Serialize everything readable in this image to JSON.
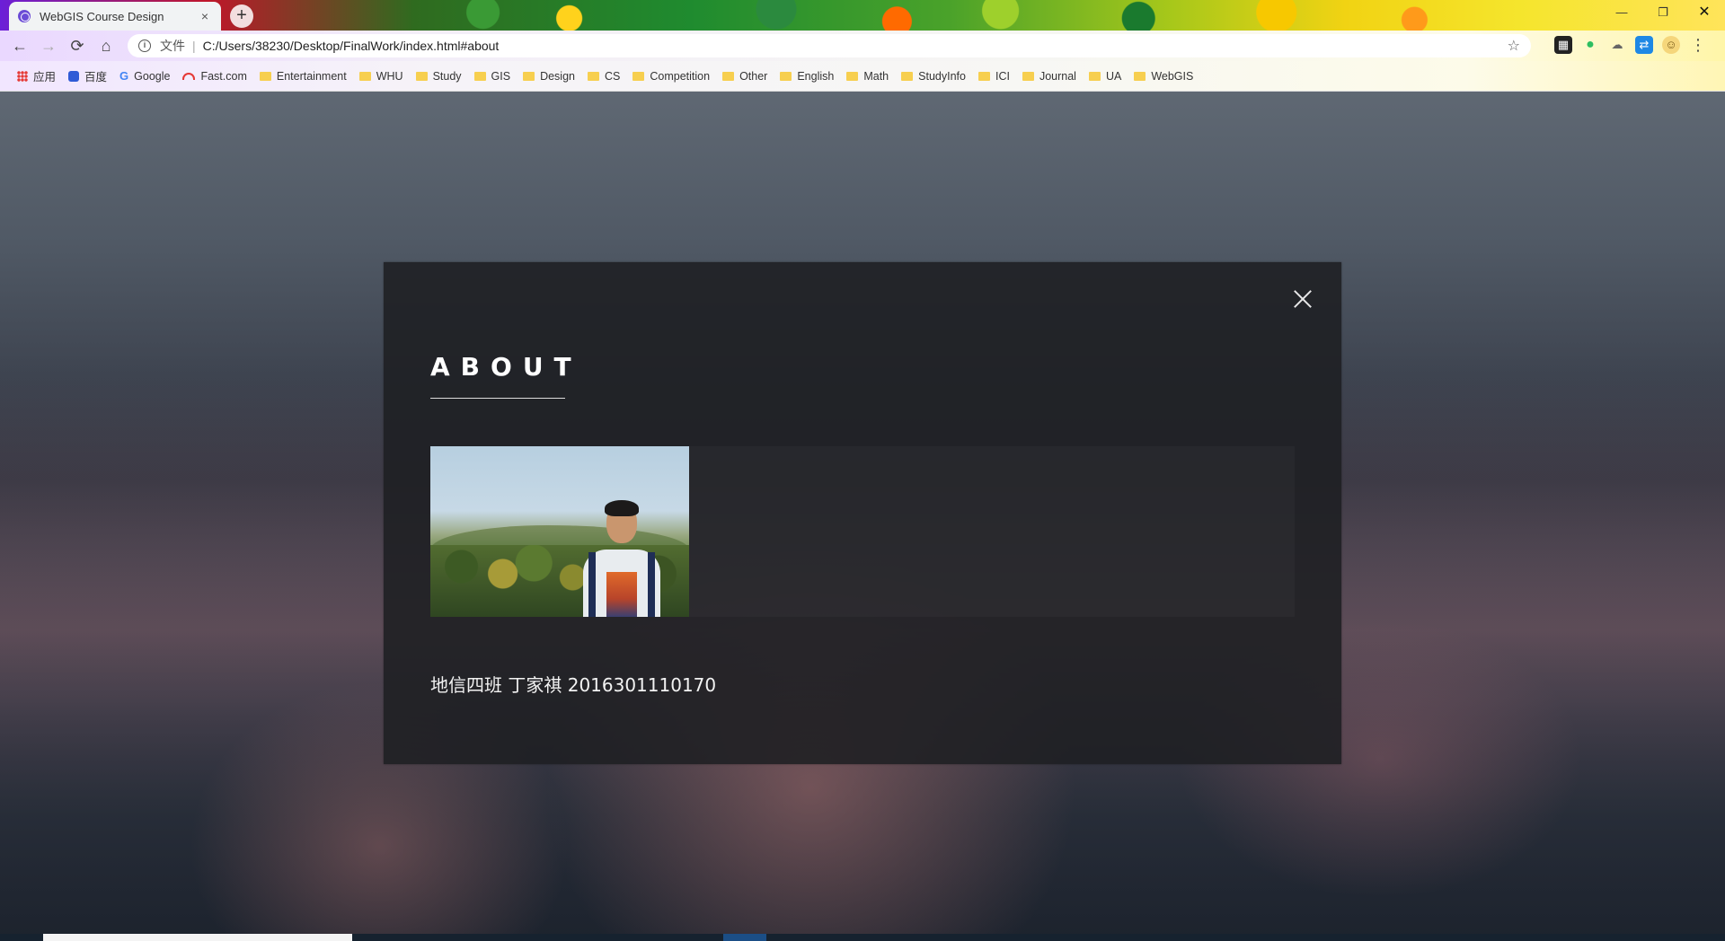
{
  "browser": {
    "tab": {
      "title": "WebGIS Course Design",
      "close_glyph": "×"
    },
    "new_tab_glyph": "+",
    "window_controls": {
      "minimize": "—",
      "maximize": "❐",
      "close": "✕"
    },
    "nav": {
      "back": "←",
      "forward": "→",
      "reload": "⟳",
      "home": "⌂"
    },
    "omnibox": {
      "info_glyph": "i",
      "scheme_label": "文件",
      "separator": "|",
      "url": "C:/Users/38230/Desktop/FinalWork/index.html#about",
      "star_glyph": "☆"
    },
    "extensions": [
      "grid-ext-icon",
      "evernote-icon",
      "cloud-ext-icon",
      "translate-ext-icon",
      "profile-avatar-icon",
      "menu-icon"
    ],
    "bookmarks": [
      {
        "label": "应用",
        "icon": "apps-grid-icon"
      },
      {
        "label": "百度",
        "icon": "baidu-icon"
      },
      {
        "label": "Google",
        "icon": "google-icon"
      },
      {
        "label": "Fast.com",
        "icon": "speedometer-icon"
      },
      {
        "label": "Entertainment",
        "icon": "folder-icon"
      },
      {
        "label": "WHU",
        "icon": "folder-icon"
      },
      {
        "label": "Study",
        "icon": "folder-icon"
      },
      {
        "label": "GIS",
        "icon": "folder-icon"
      },
      {
        "label": "Design",
        "icon": "folder-icon"
      },
      {
        "label": "CS",
        "icon": "folder-icon"
      },
      {
        "label": "Competition",
        "icon": "folder-icon"
      },
      {
        "label": "Other",
        "icon": "folder-icon"
      },
      {
        "label": "English",
        "icon": "folder-icon"
      },
      {
        "label": "Math",
        "icon": "folder-icon"
      },
      {
        "label": "StudyInfo",
        "icon": "folder-icon"
      },
      {
        "label": "ICI",
        "icon": "folder-icon"
      },
      {
        "label": "Journal",
        "icon": "folder-icon"
      },
      {
        "label": "UA",
        "icon": "folder-icon"
      },
      {
        "label": "WebGIS",
        "icon": "folder-icon"
      }
    ]
  },
  "modal": {
    "title": "ABOUT",
    "photo_alt": "portrait-photo",
    "caption": "地信四班 丁家祺 2016301110170"
  },
  "colors": {
    "modal_bg": "#1e1f22",
    "title_text": "#ffffff",
    "tab_bg": "#f1f3f4"
  }
}
